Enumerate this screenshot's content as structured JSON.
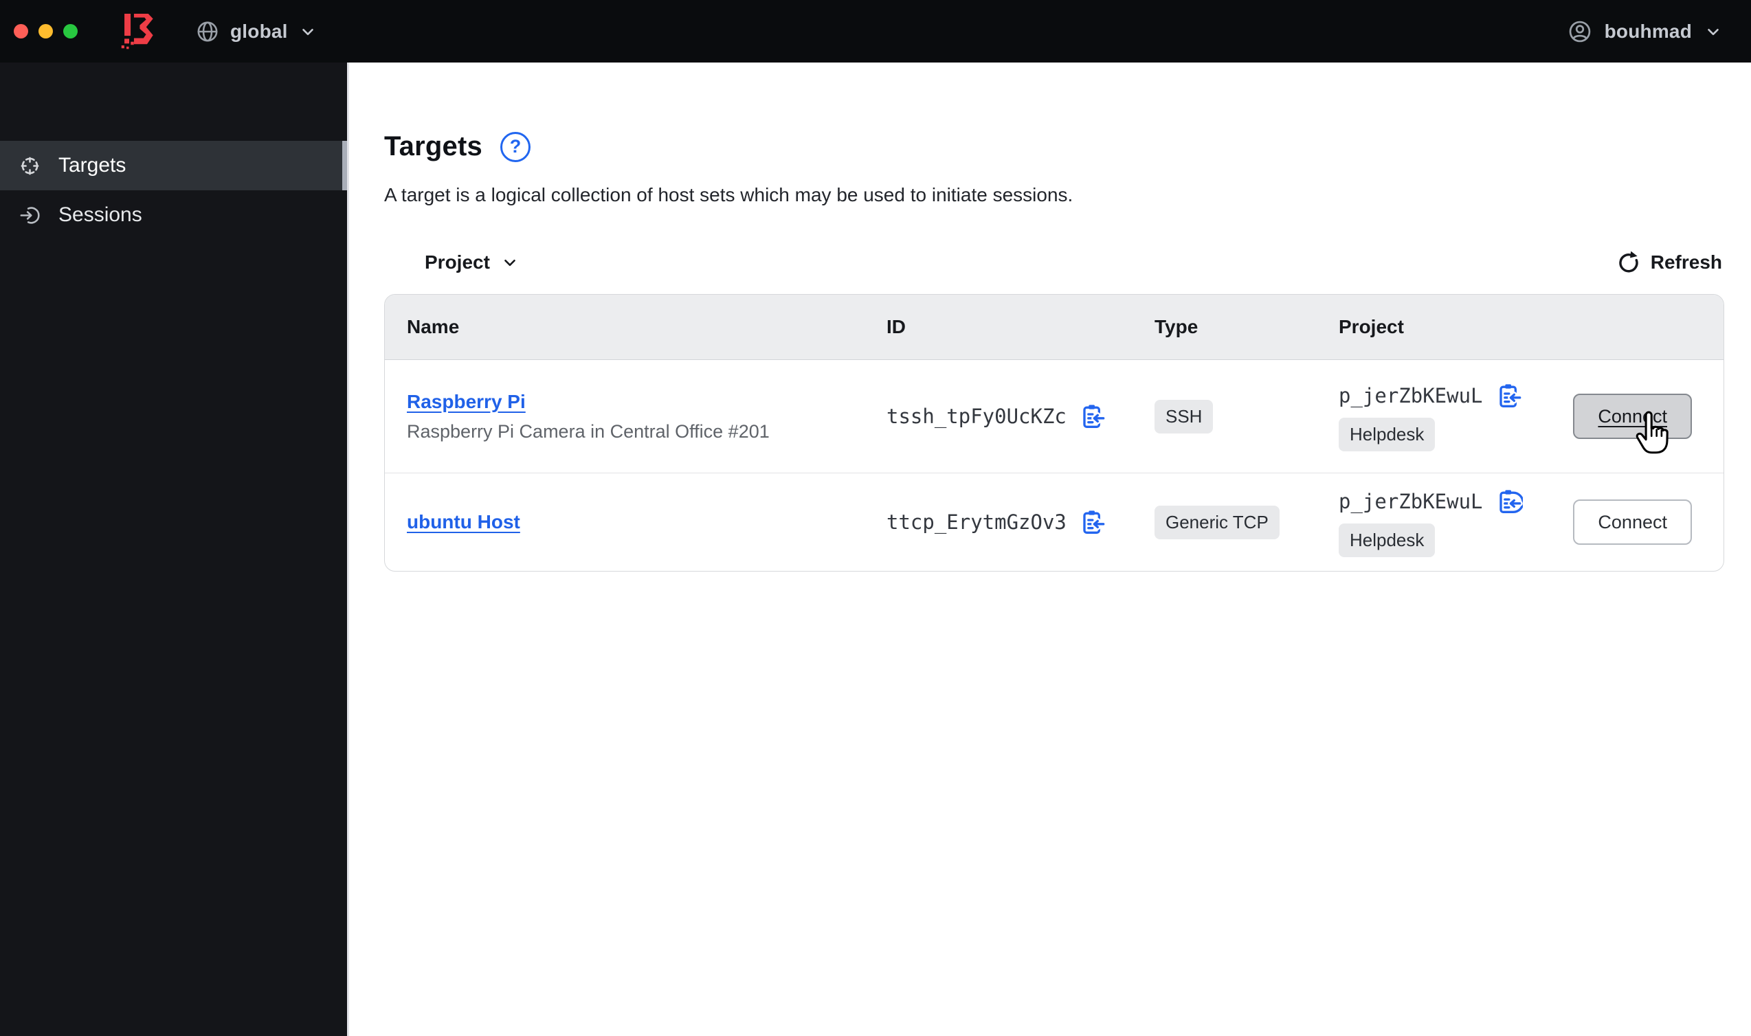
{
  "titlebar": {
    "scope_label": "global",
    "user_label": "bouhmad",
    "traffic_lights": [
      "close",
      "minimize",
      "zoom"
    ]
  },
  "sidebar": {
    "items": [
      {
        "label": "Targets",
        "icon": "target-crosshair",
        "active": true
      },
      {
        "label": "Sessions",
        "icon": "session-login",
        "active": false
      }
    ]
  },
  "page": {
    "title": "Targets",
    "help_glyph": "?",
    "description": "A target is a logical collection of host sets which may be used to initiate sessions."
  },
  "toolbar": {
    "filter_label": "Project",
    "refresh_label": "Refresh"
  },
  "table": {
    "columns": [
      "Name",
      "ID",
      "Type",
      "Project"
    ],
    "rows": [
      {
        "name": "Raspberry Pi",
        "description": "Raspberry Pi Camera in Central Office #201",
        "id": "tssh_tpFy0UcKZc",
        "type": "SSH",
        "project_id": "p_jerZbKEwuL",
        "project_name": "Helpdesk",
        "connect_label": "Connect",
        "connect_hovered": true
      },
      {
        "name": "ubuntu Host",
        "description": "",
        "id": "ttcp_ErytmGzOv3",
        "type": "Generic TCP",
        "project_id": "p_jerZbKEwuL",
        "project_name": "Helpdesk",
        "connect_label": "Connect",
        "connect_hovered": false
      }
    ]
  },
  "colors": {
    "topbar_bg": "#0a0c0e",
    "sidebar_bg": "#141519",
    "sidebar_active_bg": "#2e3237",
    "sidebar_active_indicator": "#a9aeb8",
    "accent_blue": "#2166f0",
    "link_blue": "#2061e8",
    "logo_red": "#ee3d46",
    "table_header_bg": "#ecedef",
    "badge_bg": "#e8e9eb",
    "connect_hover_bg": "#d2d3d6",
    "traffic_red": "#ff5f57",
    "traffic_yellow": "#febc2e",
    "traffic_green": "#28c840"
  }
}
